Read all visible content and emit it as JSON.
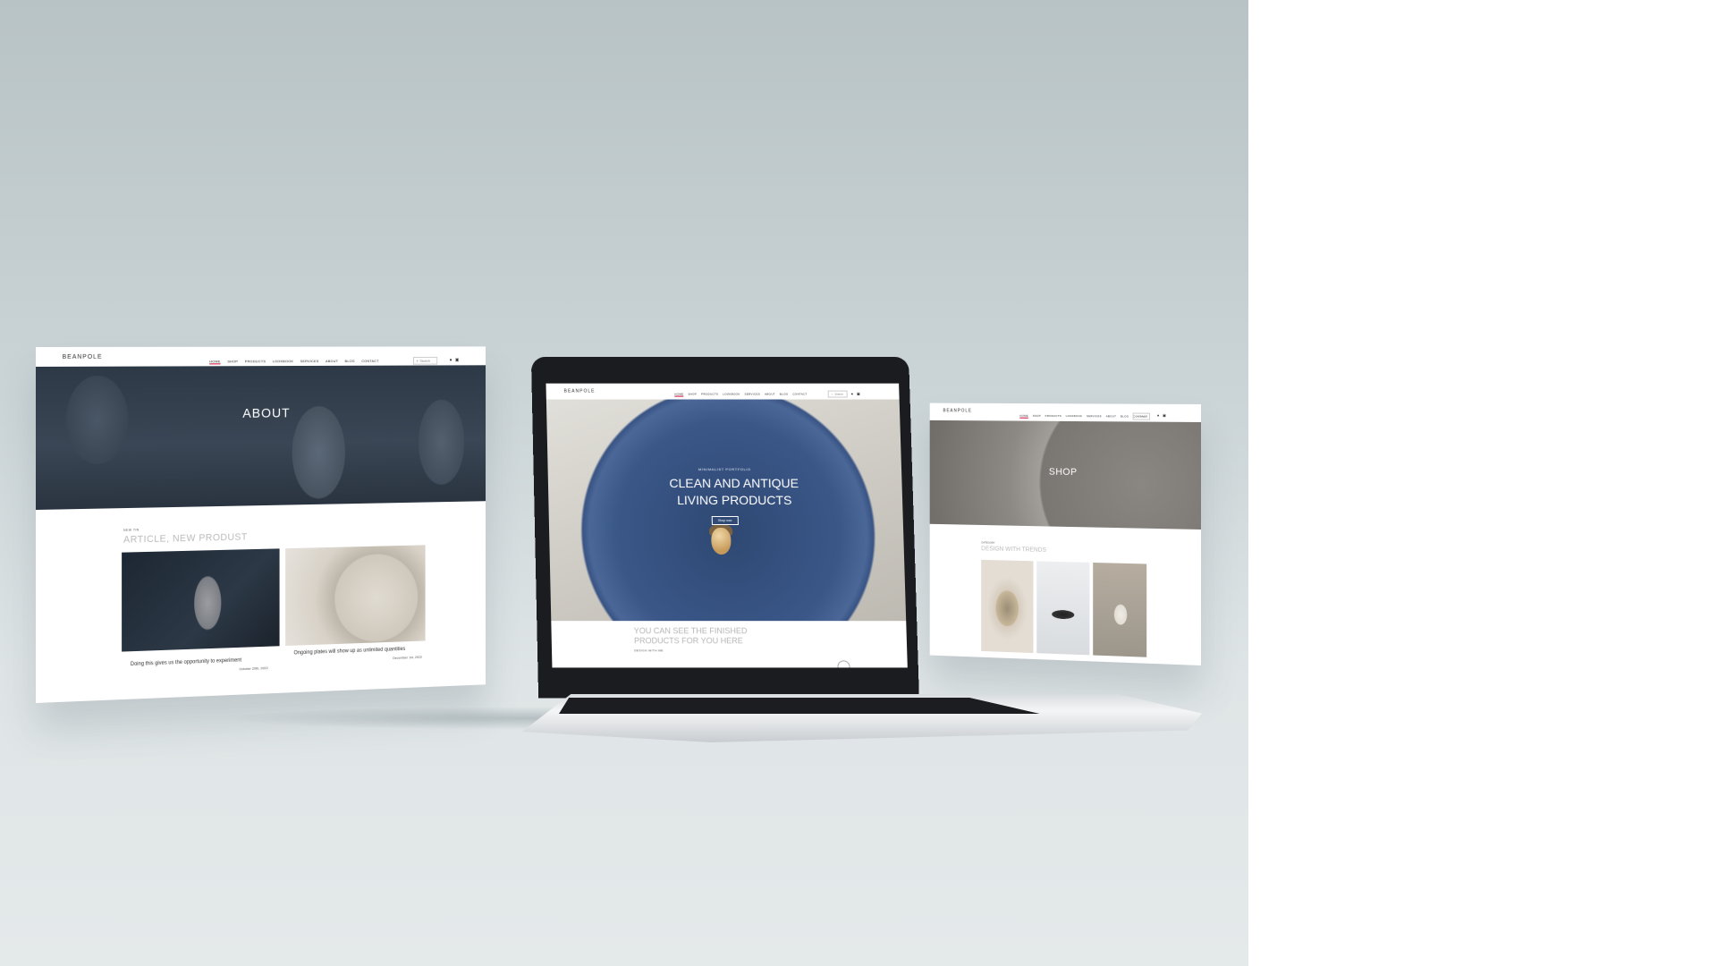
{
  "about_page": {
    "logo": "BEANPOLE",
    "nav": [
      "HOME",
      "SHOP",
      "PRODUCTS",
      "LOOKBOOK",
      "SERVICES",
      "ABOUT",
      "BLOG",
      "CONTACT"
    ],
    "search_placeholder": "Search",
    "hero_title": "ABOUT",
    "kicker": "NEW TIN",
    "section_title": "ARTICLE, NEW PRODUST",
    "cards": [
      {
        "text": "Doing this gives us the opportunity to experiment",
        "date": "October 20th, 2022"
      },
      {
        "text": "Ongoing plates will show up as unlimited quantities",
        "date": "December 1st, 2022"
      }
    ]
  },
  "laptop_page": {
    "logo": "BEANPOLE",
    "nav": [
      "HOME",
      "SHOP",
      "PRODUCTS",
      "LOOKBOOK",
      "SERVICES",
      "ABOUT",
      "BLOG",
      "CONTACT"
    ],
    "search_placeholder": "Search",
    "hero_eyebrow": "MINIMALIST PORTFOLIO",
    "hero_title": "CLEAN AND ANTIQUE LIVING PRODUCTS",
    "hero_button": "Shop now",
    "tagline_line1": "YOU CAN SEE THE FINISHED",
    "tagline_line2": "PRODUCTS FOR YOU HERE",
    "tagline_sub": "DESIGN WITH ME"
  },
  "shop_page": {
    "logo": "BEANPOLE",
    "nav": [
      "HOME",
      "SHOP",
      "PRODUCTS",
      "LOOKBOOK",
      "SERVICES",
      "ABOUT",
      "BLOG",
      "CONTACT"
    ],
    "search_placeholder": "Search",
    "hero_title": "SHOP",
    "kicker": "CATEGORY",
    "section_title": "DESIGN WITH TRENDS"
  },
  "icons": [
    "search-icon",
    "user-icon",
    "cart-icon",
    "camera-icon"
  ]
}
